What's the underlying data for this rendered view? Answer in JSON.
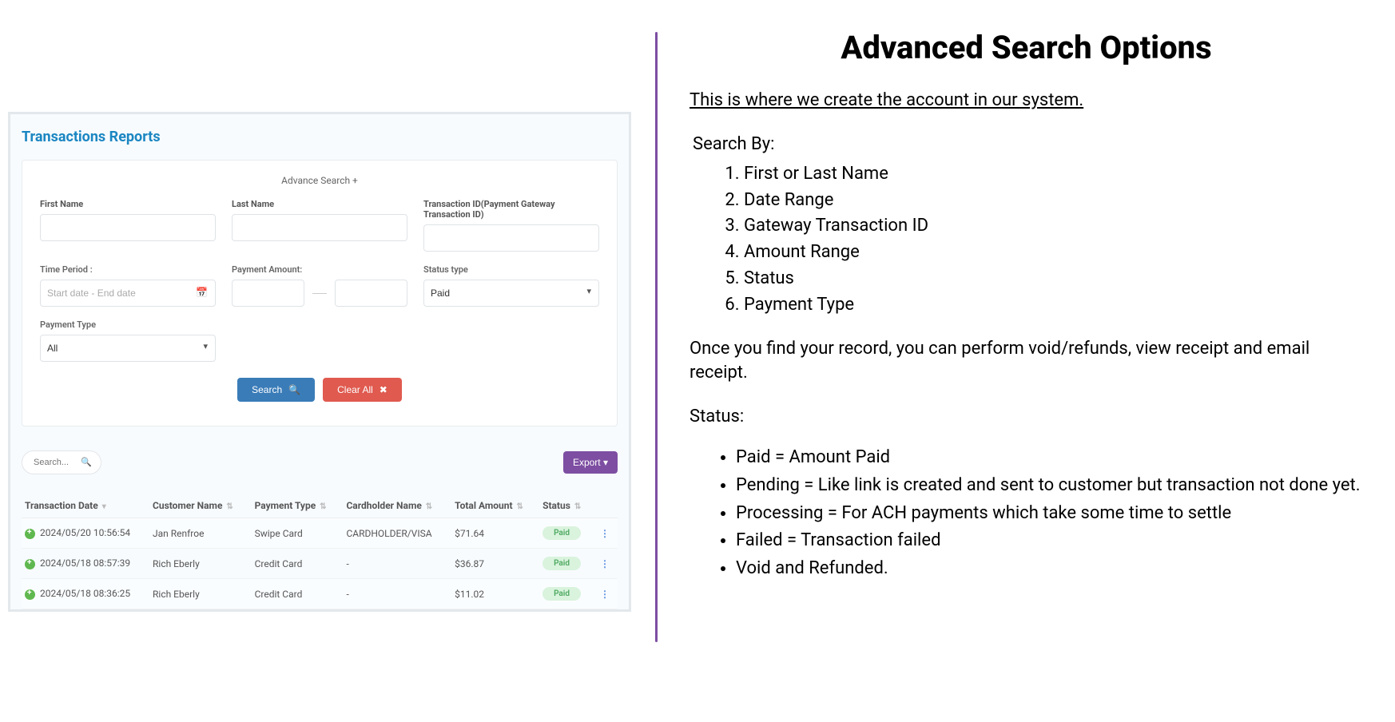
{
  "left": {
    "page_title": "Transactions Reports",
    "adv_search_toggle": "Advance Search +",
    "labels": {
      "first_name": "First Name",
      "last_name": "Last Name",
      "txn_id": "Transaction ID(Payment Gateway Transaction ID)",
      "time_period": "Time Period :",
      "payment_amount": "Payment Amount:",
      "status_type": "Status type",
      "payment_type": "Payment Type"
    },
    "placeholders": {
      "date_range": "Start date - End date",
      "table_search": "Search..."
    },
    "selects": {
      "status_value": "Paid",
      "payment_type_value": "All"
    },
    "buttons": {
      "search": "Search",
      "clear_all": "Clear All",
      "export": "Export "
    },
    "table": {
      "headers": {
        "transaction_date": "Transaction Date",
        "customer_name": "Customer Name",
        "payment_type": "Payment Type",
        "cardholder_name": "Cardholder Name",
        "total_amount": "Total Amount",
        "status": "Status"
      },
      "rows": [
        {
          "date": "2024/05/20 10:56:54",
          "customer": "Jan Renfroe",
          "ptype": "Swipe Card",
          "cardholder": "CARDHOLDER/VISA",
          "amount": "$71.64",
          "status": "Paid"
        },
        {
          "date": "2024/05/18 08:57:39",
          "customer": "Rich Eberly",
          "ptype": "Credit Card",
          "cardholder": "-",
          "amount": "$36.87",
          "status": "Paid"
        },
        {
          "date": "2024/05/18 08:36:25",
          "customer": "Rich Eberly",
          "ptype": "Credit Card",
          "cardholder": "-",
          "amount": "$11.02",
          "status": "Paid"
        }
      ]
    }
  },
  "right": {
    "title": "Advanced Search Options",
    "intro": "This is where we create the account in our system. ",
    "search_by_label": "Search By:",
    "search_by": [
      "First or Last Name",
      "Date Range",
      "Gateway Transaction ID",
      "Amount Range",
      "Status",
      "Payment Type"
    ],
    "found_record": "Once you find your record, you can perform void/refunds, view receipt and email receipt.",
    "status_label": "Status:",
    "status_items": [
      "Paid = Amount Paid",
      "Pending = Like link is created and sent to customer but transaction not done yet.",
      "Processing  = For ACH payments which take some time to settle",
      "Failed  = Transaction failed",
      "Void and Refunded."
    ]
  }
}
